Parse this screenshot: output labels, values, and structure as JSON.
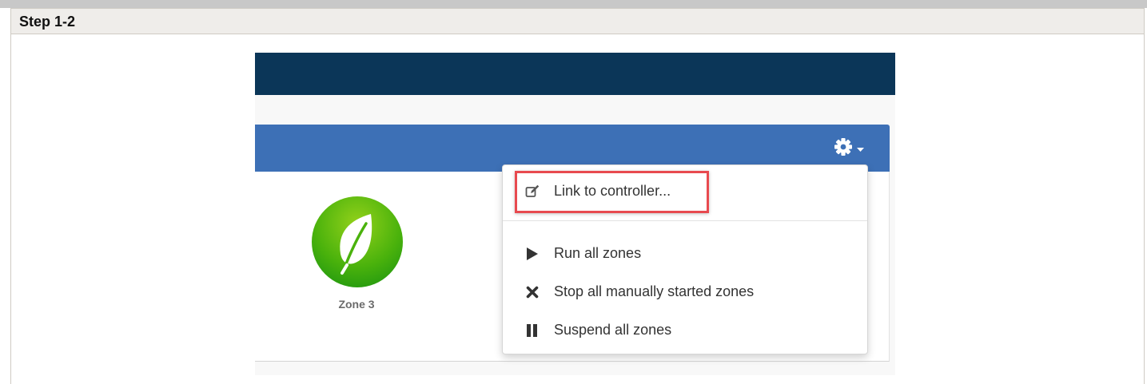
{
  "step": {
    "title": "Step 1-2"
  },
  "colors": {
    "navbar": "#0b3658",
    "panel_header": "#3d70b6",
    "highlight": "#e84a4f",
    "zone_green": "#4ab20c"
  },
  "toolbar": {
    "settings_icon": "gear-icon",
    "caret_icon": "caret-down-icon"
  },
  "zone": {
    "label": "Zone 3",
    "icon": "leaf-icon"
  },
  "menu": {
    "items": [
      {
        "label": "Link to controller...",
        "icon": "edit-icon"
      },
      {
        "label": "Run all zones",
        "icon": "play-icon"
      },
      {
        "label": "Stop all manually started zones",
        "icon": "close-icon"
      },
      {
        "label": "Suspend all zones",
        "icon": "pause-icon"
      }
    ]
  }
}
